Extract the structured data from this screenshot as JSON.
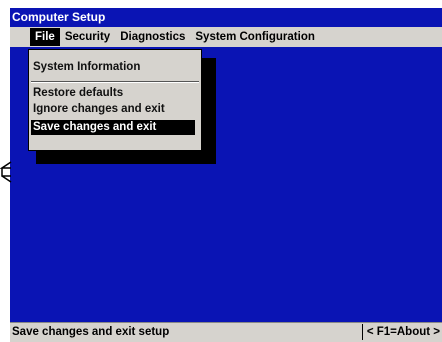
{
  "window": {
    "title": "Computer Setup"
  },
  "menu_bar": {
    "items": [
      {
        "label": "File"
      },
      {
        "label": "Security"
      },
      {
        "label": "Diagnostics"
      },
      {
        "label": "System Configuration"
      }
    ]
  },
  "file_menu": {
    "items": [
      {
        "label": "System Information"
      },
      {
        "label": "Restore defaults"
      },
      {
        "label": "Ignore changes and exit"
      },
      {
        "label": "Save changes and exit"
      }
    ],
    "selected": "Save changes and exit"
  },
  "status_bar": {
    "text": "Save changes and exit setup",
    "help": "< F1=About >"
  },
  "colors": {
    "background": "#0a14b4",
    "menu": "#d6d3ce",
    "highlight": "#000000"
  }
}
